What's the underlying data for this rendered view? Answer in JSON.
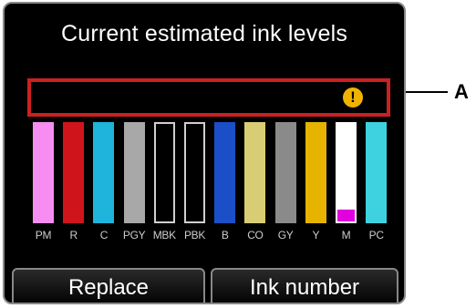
{
  "title": "Current estimated ink levels",
  "warning_icon": "exclamation-warning-icon",
  "inks": [
    {
      "label": "PM",
      "color": "#f58ef0",
      "border": "#f58ef0",
      "level": 1.0
    },
    {
      "label": "R",
      "color": "#d0141c",
      "border": "#d0141c",
      "level": 1.0
    },
    {
      "label": "C",
      "color": "#1eb4dc",
      "border": "#1eb4dc",
      "level": 1.0
    },
    {
      "label": "PGY",
      "color": "#a8a8a8",
      "border": "#a8a8a8",
      "level": 1.0
    },
    {
      "label": "MBK",
      "color": "#000000",
      "border": "#cfcfcf",
      "level": 1.0
    },
    {
      "label": "PBK",
      "color": "#000000",
      "border": "#cfcfcf",
      "level": 1.0
    },
    {
      "label": "B",
      "color": "#1a4fc8",
      "border": "#1a4fc8",
      "level": 1.0
    },
    {
      "label": "CO",
      "color": "#d8cd74",
      "border": "#d8cd74",
      "level": 1.0
    },
    {
      "label": "GY",
      "color": "#8a8a8a",
      "border": "#8a8a8a",
      "level": 1.0
    },
    {
      "label": "Y",
      "color": "#e6b400",
      "border": "#e6b400",
      "level": 1.0
    },
    {
      "label": "M",
      "color": "#e000e0",
      "border": "#ffffff",
      "level": 0.12,
      "bg": "#ffffff"
    },
    {
      "label": "PC",
      "color": "#3ed2e0",
      "border": "#3ed2e0",
      "level": 1.0
    }
  ],
  "buttons": {
    "replace": "Replace",
    "ink_number": "Ink number"
  },
  "callout": "A",
  "accent_colors": {
    "highlight_border": "#cc2020",
    "warning": "#f0b400"
  }
}
